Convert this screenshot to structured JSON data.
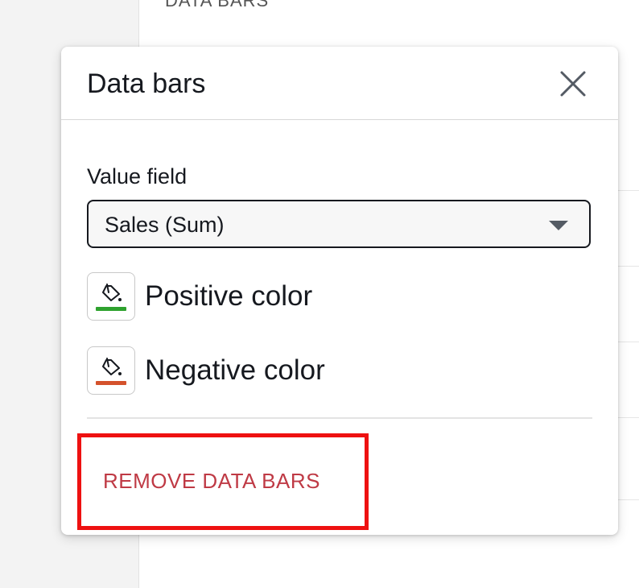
{
  "background": {
    "section_heading": "DATA BARS"
  },
  "popover": {
    "title": "Data bars",
    "close_icon": "close-icon"
  },
  "value_field": {
    "label": "Value field",
    "selected": "Sales (Sum)"
  },
  "colors": [
    {
      "label": "Positive color",
      "icon": "paint-bucket-icon",
      "color": "#2ea22e"
    },
    {
      "label": "Negative color",
      "icon": "paint-bucket-icon",
      "color": "#d4522c"
    }
  ],
  "actions": {
    "remove_label": "REMOVE DATA BARS"
  },
  "accent": {
    "remove_text": "#bf3a45",
    "highlight": "#ee1111"
  }
}
